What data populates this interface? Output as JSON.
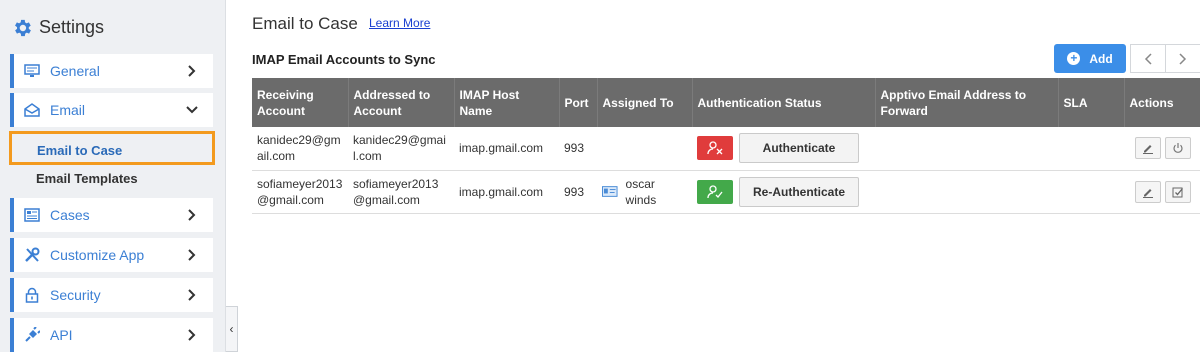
{
  "sidebar": {
    "title": "Settings",
    "items": [
      {
        "label": "General",
        "icon": "monitor-icon"
      },
      {
        "label": "Email",
        "icon": "envelope-icon"
      },
      {
        "label": "Cases",
        "icon": "cases-icon"
      },
      {
        "label": "Customize App",
        "icon": "tools-icon"
      },
      {
        "label": "Security",
        "icon": "lock-icon"
      },
      {
        "label": "API",
        "icon": "plug-icon"
      }
    ],
    "email_subitems": [
      {
        "label": "Email to Case",
        "active": true
      },
      {
        "label": "Email Templates",
        "active": false
      }
    ],
    "collapse_glyph": "‹"
  },
  "main": {
    "title": "Email to Case",
    "learn_more": "Learn More",
    "section_title": "IMAP Email Accounts to Sync",
    "add_label": "Add"
  },
  "table": {
    "headers": [
      "Receiving Account",
      "Addressed to Account",
      "IMAP Host Name",
      "Port",
      "Assigned To",
      "Authentication Status",
      "Apptivo Email Address to Forward",
      "SLA",
      "Actions"
    ],
    "rows": [
      {
        "receiving": "kanidec29@gmail.com",
        "addressed": "kanidec29@gmail.com",
        "host": "imap.gmail.com",
        "port": "993",
        "assigned": "",
        "status": "unauthenticated",
        "auth_button": "Authenticate",
        "forward": "",
        "sla": ""
      },
      {
        "receiving": "sofiameyer2013@gmail.com",
        "addressed": "sofiameyer2013@gmail.com",
        "host": "imap.gmail.com",
        "port": "993",
        "assigned": "oscar winds",
        "status": "authenticated",
        "auth_button": "Re-Authenticate",
        "forward": "",
        "sla": ""
      }
    ]
  },
  "colors": {
    "accent": "#3b7fd4",
    "highlight": "#f39a1e",
    "header_bg": "#6b6b6b",
    "status_red": "#e03c3c",
    "status_green": "#43a94a"
  }
}
